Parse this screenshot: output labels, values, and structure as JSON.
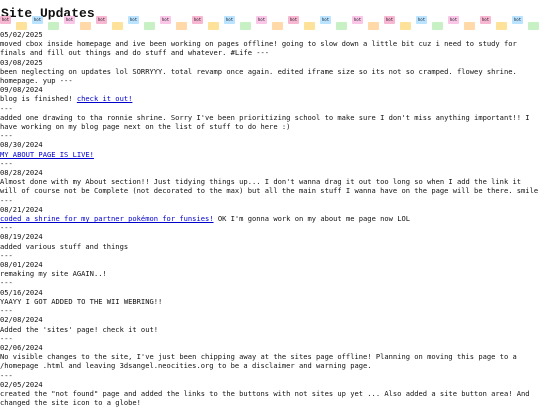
{
  "page": {
    "title": "Site Updates"
  },
  "border": {
    "chip_label": "hot",
    "colors": [
      "#f7b6d2",
      "#ffe29a",
      "#b9e3ff",
      "#c7f0c4",
      "#f9c6e8",
      "#ffd9a8"
    ]
  },
  "entries": [
    {
      "date": "05/02/2025",
      "text": "moved cbox inside homepage and ive been working on pages offline! going to slow down a little bit cuz i need to study for finals and fill out things and do stuff and whatever. #Life ---",
      "link": "",
      "after": ""
    },
    {
      "date": "03/08/2025",
      "text": "been neglecting on updates lol SORRYYY. total revamp once again. edited iframe size so its not so cramped. flowey shrine. homepage. yup ---",
      "link": "",
      "after": ""
    },
    {
      "date": "09/08/2024",
      "text": "blog is finished! ",
      "link": "check it out!",
      "after": ""
    },
    {
      "date": "---",
      "text": "added one drawing to tha ronnie shrine. Sorry I've been prioritizing school to make sure I don't miss anything important!! I have working on my blog page next on the list of stuff to do here :)",
      "link": "",
      "after": ""
    },
    {
      "date": "---\n08/30/2024",
      "text": "",
      "link": "MY ABOUT PAGE IS LIVE!",
      "after": ""
    },
    {
      "date": "---\n08/28/2024",
      "text": "Almost done with my About section!! Just tidying things up... I don't wanna drag it out too long so when I add the link it will of course not be Complete (not decorated to the max) but all the main stuff I wanna have on the page will be there. smile",
      "link": "",
      "after": ""
    },
    {
      "date": "---\n08/21/2024",
      "text": "",
      "link": "coded a shrine for my partner pokémon for funsies!",
      "after": " OK I'm gonna work on my about me page now LOL"
    },
    {
      "date": "---\n08/19/2024",
      "text": "added various stuff and things",
      "link": "",
      "after": ""
    },
    {
      "date": "---\n08/01/2024",
      "text": "remaking my site AGAIN..!",
      "link": "",
      "after": ""
    },
    {
      "date": "---\n05/16/2024",
      "text": "YAAYY I GOT ADDED TO THE WII WEBRING!!",
      "link": "",
      "after": ""
    },
    {
      "date": "---\n02/08/2024",
      "text": "Added the 'sites' page! check it out!",
      "link": "",
      "after": ""
    },
    {
      "date": "---\n02/06/2024",
      "text": "No visible changes to the site, I've just been chipping away at the sites page offline! Planning on moving this page to a /homepage .html and leaving 3dsangel.neocities.org to be a disclaimer and warning page.",
      "link": "",
      "after": ""
    },
    {
      "date": "---\n02/05/2024",
      "text": "created the \"not found\" page and added the links to the buttons with not sites up yet ... Also added a site button area! And changed the site icon to a globe!",
      "link": "",
      "after": ""
    }
  ]
}
